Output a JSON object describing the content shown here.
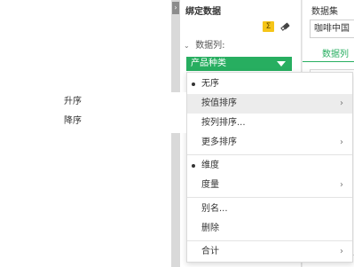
{
  "collapse_arrow": "›",
  "binding": {
    "title": "绑定数据",
    "sigma_icon": "Σ",
    "eraser_icon": "eraser-icon",
    "field_section_label": "数据列:",
    "field_section_chevron": "⌄",
    "field_pill_label": "产品种类"
  },
  "dataset": {
    "label": "数据集",
    "selected": "咖啡中国",
    "tab": "数据列"
  },
  "menu": {
    "items": [
      {
        "label": "无序",
        "selected": true
      },
      {
        "label": "按值排序",
        "has_submenu": true,
        "highlight": true
      },
      {
        "label": "按列排序..."
      },
      {
        "label": "更多排序",
        "has_submenu": true
      },
      {
        "label": "维度",
        "selected": true
      },
      {
        "label": "度量",
        "has_submenu": true
      },
      {
        "label": "别名..."
      },
      {
        "label": "删除"
      },
      {
        "label": "合计",
        "has_submenu": true
      }
    ],
    "submenu_arrow": "›"
  },
  "submenu": {
    "items": [
      "升序",
      "降序"
    ]
  },
  "colors": {
    "accent_green": "#27ae60",
    "sigma_yellow": "#f5c518"
  }
}
